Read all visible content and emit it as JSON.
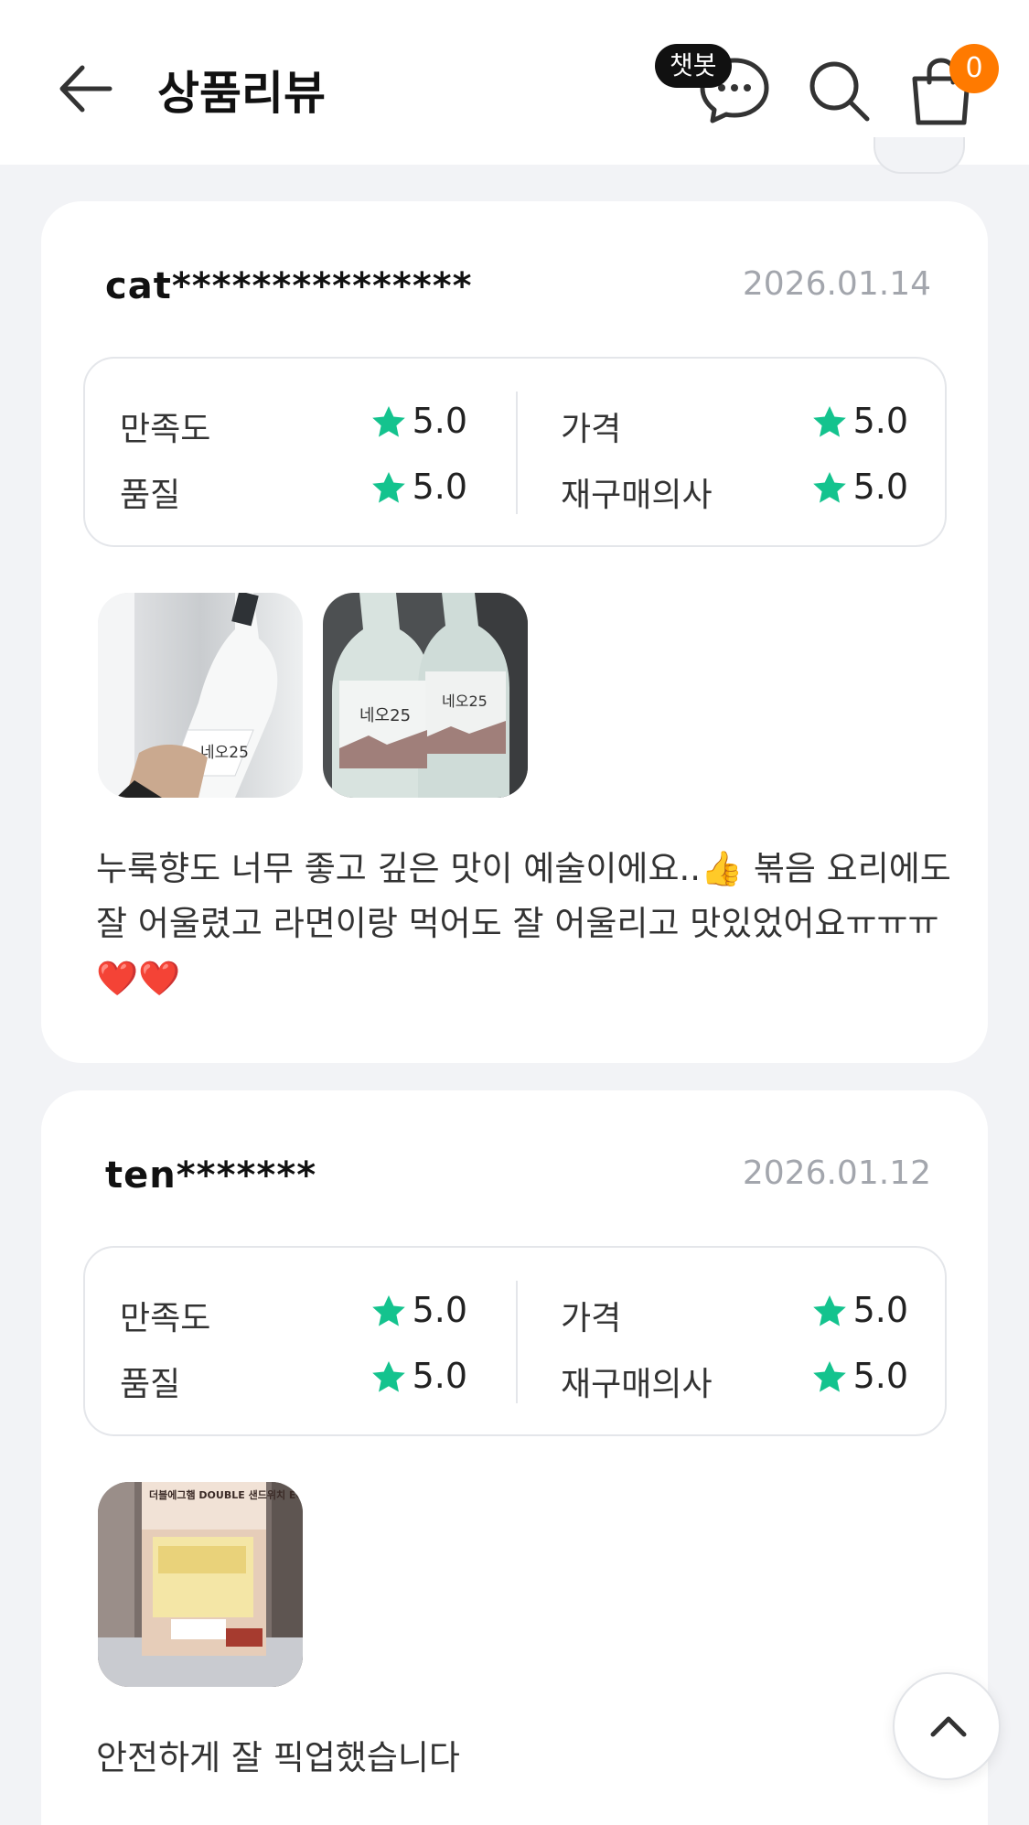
{
  "header": {
    "title": "상품리뷰",
    "chatbot_label": "챗봇",
    "cart_count": "0"
  },
  "ratings_labels": {
    "satisfaction": "만족도",
    "price": "가격",
    "quality": "품질",
    "repurchase": "재구매의사"
  },
  "reviews": [
    {
      "user": "cat***************",
      "date": "2026.01.14",
      "ratings": {
        "satisfaction": "5.0",
        "price": "5.0",
        "quality": "5.0",
        "repurchase": "5.0"
      },
      "text": "누룩향도 너무 좋고 깊은 맛이 예술이에요..👍 볶음 요리에도 잘 어울렸고 라면이랑 먹어도 잘 어울리고 맛있었어요ㅠㅠㅠ❤️❤️",
      "photos": [
        {
          "label": "네오25"
        },
        {
          "label": "네오25"
        }
      ]
    },
    {
      "user": "ten*******",
      "date": "2026.01.12",
      "ratings": {
        "satisfaction": "5.0",
        "price": "5.0",
        "quality": "5.0",
        "repurchase": "5.0"
      },
      "text": "안전하게 잘 픽업했습니다",
      "photos": [
        {
          "label": "더블에그햄 DOUBLE 샌드위치 EGG & HAM"
        }
      ]
    }
  ],
  "colors": {
    "star": "#14c38e",
    "badge": "#ff7a00",
    "background": "#f2f3f6"
  },
  "icons": [
    "back-arrow-icon",
    "chat-icon",
    "search-icon",
    "cart-icon",
    "star-icon",
    "chevron-up-icon"
  ]
}
